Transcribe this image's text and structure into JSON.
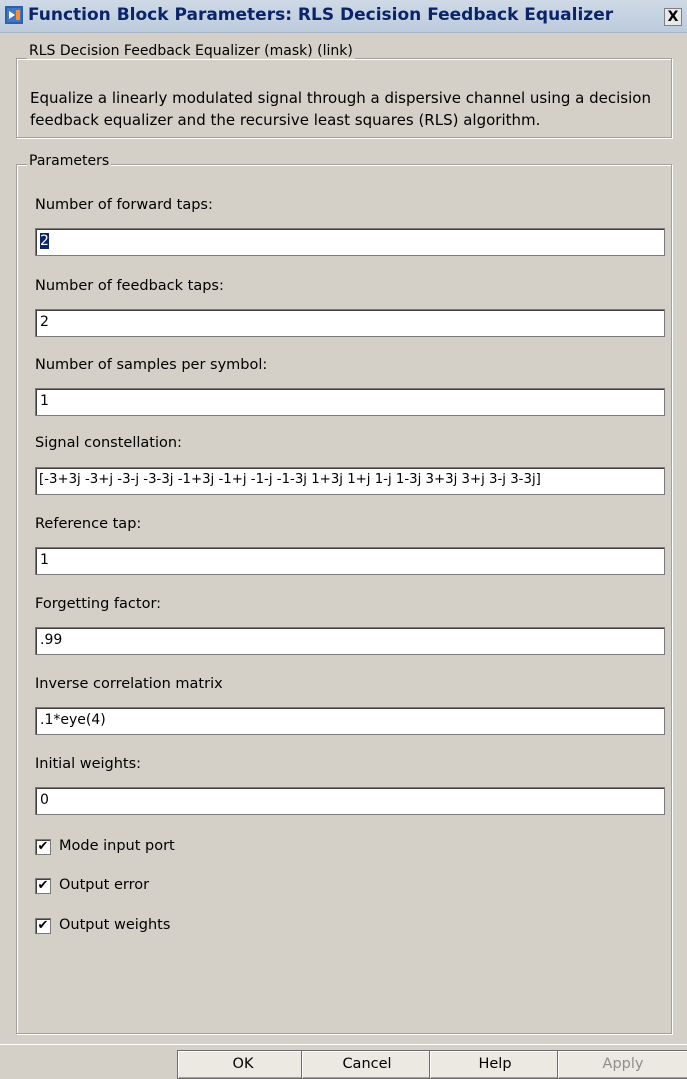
{
  "window": {
    "title": "Function Block Parameters: RLS Decision Feedback Equalizer",
    "close_label": "X",
    "icon": "simulink-block-icon"
  },
  "description_group": {
    "legend": "RLS Decision Feedback Equalizer (mask) (link)",
    "text": "Equalize a linearly modulated signal through a dispersive channel using a decision feedback equalizer and the recursive least squares (RLS) algorithm."
  },
  "parameters": {
    "legend": "Parameters",
    "fields": [
      {
        "label": "Number of forward taps:",
        "value": "2"
      },
      {
        "label": "Number of feedback taps:",
        "value": "2"
      },
      {
        "label": "Number of samples per symbol:",
        "value": "1"
      },
      {
        "label": "Signal constellation:",
        "value": "[-3+3j -3+j -3-j -3-3j -1+3j -1+j -1-j -1-3j 1+3j 1+j 1-j 1-3j 3+3j 3+j 3-j 3-3j]"
      },
      {
        "label": "Reference tap:",
        "value": "1"
      },
      {
        "label": "Forgetting factor:",
        "value": ".99"
      },
      {
        "label": "Inverse correlation matrix",
        "value": ".1*eye(4)"
      },
      {
        "label": "Initial weights:",
        "value": "0"
      }
    ],
    "checkboxes": [
      {
        "label": "Mode input port",
        "checked": true
      },
      {
        "label": "Output error",
        "checked": true
      },
      {
        "label": "Output weights",
        "checked": true
      }
    ],
    "check_mark": "✔"
  },
  "buttons": {
    "ok": "OK",
    "cancel": "Cancel",
    "help": "Help",
    "apply": "Apply"
  },
  "colors": {
    "title_text": "#0a246a",
    "selection": "#0a246a",
    "dialog_bg": "#d4d0c8"
  }
}
